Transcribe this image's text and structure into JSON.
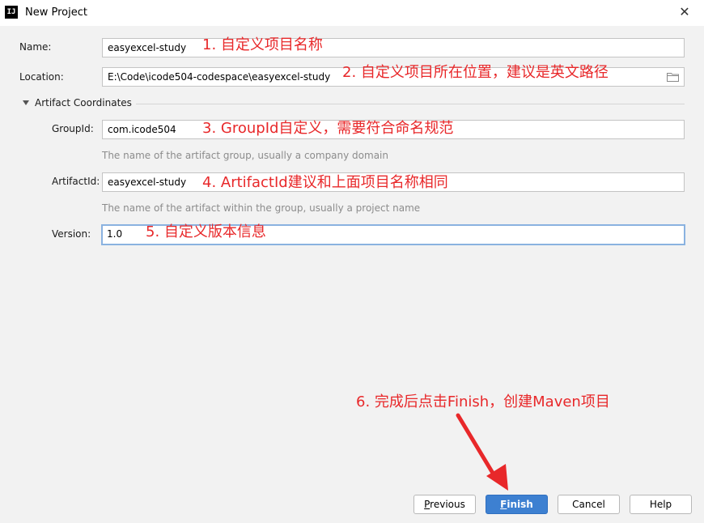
{
  "window": {
    "title": "New Project",
    "app_icon": "IJ",
    "close_glyph": "✕"
  },
  "form": {
    "name": {
      "label": "Name:",
      "value": "easyexcel-study"
    },
    "location": {
      "label": "Location:",
      "value": "E:\\Code\\icode504-codespace\\easyexcel-study"
    },
    "section_title": "Artifact Coordinates",
    "group_id": {
      "label": "GroupId:",
      "value": "com.icode504",
      "hint": "The name of the artifact group, usually a company domain"
    },
    "artifact_id": {
      "label": "ArtifactId:",
      "value": "easyexcel-study",
      "hint": "The name of the artifact within the group, usually a project name"
    },
    "version": {
      "label": "Version:",
      "value": "1.0"
    }
  },
  "annotations": {
    "a1": "1. 自定义项目名称",
    "a2": "2. 自定义项目所在位置，建议是英文路径",
    "a3": "3. GroupId自定义，需要符合命名规范",
    "a4": "4. ArtifactId建议和上面项目名称相同",
    "a5": "5. 自定义版本信息",
    "a6": "6. 完成后点击Finish，创建Maven项目"
  },
  "buttons": {
    "previous": {
      "mnemonic": "P",
      "rest": "revious"
    },
    "finish": {
      "mnemonic": "F",
      "rest": "inish"
    },
    "cancel": "Cancel",
    "help": "Help"
  },
  "colors": {
    "annotation": "#e8282a",
    "primary_button": "#3d80d1",
    "focus_border": "#8ab2e0"
  },
  "icons": [
    "folder-icon",
    "close-icon",
    "collapse-triangle-icon",
    "arrow-annotation-icon"
  ]
}
